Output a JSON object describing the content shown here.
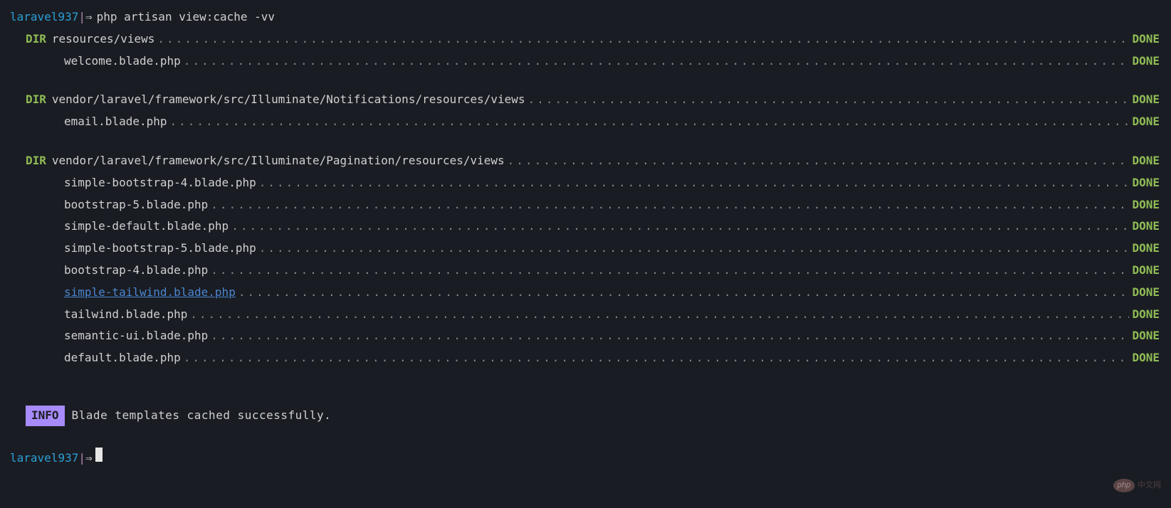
{
  "prompt": {
    "host": "laravel937",
    "sep": "|",
    "arrow": "⇒",
    "command": "php artisan view:cache -vv"
  },
  "status_label": "DONE",
  "dir_label": "DIR",
  "groups": [
    {
      "path": "resources/views",
      "files": [
        {
          "name": "welcome.blade.php",
          "link": false
        }
      ]
    },
    {
      "path": "vendor/laravel/framework/src/Illuminate/Notifications/resources/views",
      "files": [
        {
          "name": "email.blade.php",
          "link": false
        }
      ]
    },
    {
      "path": "vendor/laravel/framework/src/Illuminate/Pagination/resources/views",
      "files": [
        {
          "name": "simple-bootstrap-4.blade.php",
          "link": false
        },
        {
          "name": "bootstrap-5.blade.php",
          "link": false
        },
        {
          "name": "simple-default.blade.php",
          "link": false
        },
        {
          "name": "simple-bootstrap-5.blade.php",
          "link": false
        },
        {
          "name": "bootstrap-4.blade.php",
          "link": false
        },
        {
          "name": "simple-tailwind.blade.php",
          "link": true
        },
        {
          "name": "tailwind.blade.php",
          "link": false
        },
        {
          "name": "semantic-ui.blade.php",
          "link": false
        },
        {
          "name": "default.blade.php",
          "link": false
        }
      ]
    }
  ],
  "info": {
    "badge": "INFO",
    "text": "Blade templates cached successfully."
  },
  "watermark": {
    "logo": "php",
    "text": "中文网"
  }
}
